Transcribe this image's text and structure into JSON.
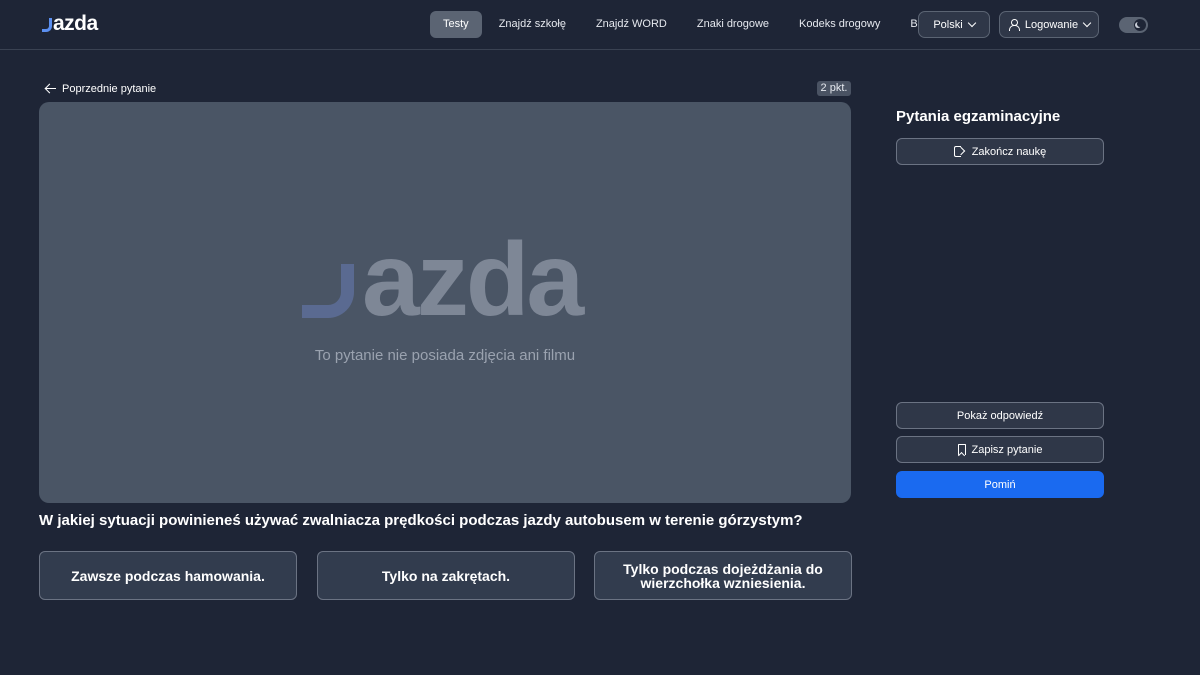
{
  "header": {
    "logo_text": "azda",
    "nav": [
      {
        "label": "Testy",
        "active": true
      },
      {
        "label": "Znajdź szkołę",
        "active": false
      },
      {
        "label": "Znajdź WORD",
        "active": false
      },
      {
        "label": "Znaki drogowe",
        "active": false
      },
      {
        "label": "Kodeks drogowy",
        "active": false
      },
      {
        "label": "Blog",
        "active": false
      }
    ],
    "language": "Polski",
    "login": "Logowanie",
    "theme_toggle": "dark-mode-moon-icon"
  },
  "main": {
    "prev_link": "Poprzednie pytanie",
    "points": "2 pkt.",
    "media": {
      "logo_text": "azda",
      "caption": "To pytanie nie posiada zdjęcia ani filmu"
    },
    "question": "W jakiej sytuacji powinieneś używać zwalniacza prędkości podczas jazdy autobusem w terenie górzystym?",
    "answers": [
      "Zawsze podczas hamowania.",
      "Tylko na zakrętach.",
      "Tylko podczas dojeżdżania do wierzchołka wzniesienia."
    ]
  },
  "sidebar": {
    "title": "Pytania egzaminacyjne",
    "finish_label": "Zakończ naukę",
    "show_answer_label": "Pokaż odpowiedź",
    "save_label": "Zapisz pytanie",
    "skip_label": "Pomiń"
  },
  "colors": {
    "background": "#1e2536",
    "accent": "#1a6af0",
    "media_background": "#4a5565"
  }
}
